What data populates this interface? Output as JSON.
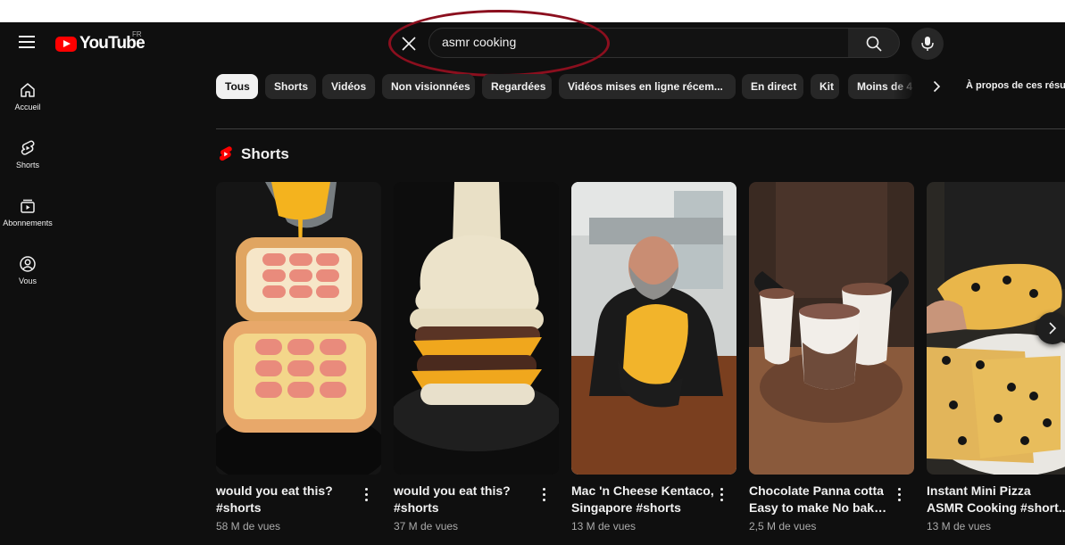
{
  "header": {
    "logo_text": "YouTube",
    "country_code": "FR",
    "search": {
      "value": "asmr cooking"
    }
  },
  "sidebar": {
    "items": [
      {
        "label": "Accueil",
        "icon": "home-icon"
      },
      {
        "label": "Shorts",
        "icon": "shorts-icon"
      },
      {
        "label": "Abonnements",
        "icon": "subscriptions-icon"
      },
      {
        "label": "Vous",
        "icon": "user-icon"
      }
    ]
  },
  "chips": [
    {
      "label": "Tous",
      "active": true
    },
    {
      "label": "Shorts"
    },
    {
      "label": "Vidéos"
    },
    {
      "label": "Non visionnées"
    },
    {
      "label": "Regardées"
    },
    {
      "label": "Vidéos mises en ligne récem..."
    },
    {
      "label": "En direct"
    },
    {
      "label": "Kit"
    },
    {
      "label": "Moins de 4"
    }
  ],
  "about_label": "À propos de ces résu",
  "shorts_section": {
    "title": "Shorts",
    "items": [
      {
        "title_line1": "would you eat this?",
        "title_line2": "#shorts",
        "views": "58 M de vues"
      },
      {
        "title_line1": "would you eat this?",
        "title_line2": "#shorts",
        "views": "37 M de vues"
      },
      {
        "title_line1": "Mac 'n Cheese Kentaco,",
        "title_line2": "Singapore #shorts",
        "views": "13 M de vues"
      },
      {
        "title_line1": "Chocolate Panna cotta",
        "title_line2": "Easy to make No bake ...",
        "views": "2,5 M de vues"
      },
      {
        "title_line1": "Instant Mini Pizza",
        "title_line2": "ASMR Cooking #short...",
        "views": "13 M de vues"
      }
    ]
  },
  "colors": {
    "brand_red": "#ff0000",
    "background": "#0f0f0f",
    "chip": "#272727",
    "annotation": "#8b0f1e"
  }
}
